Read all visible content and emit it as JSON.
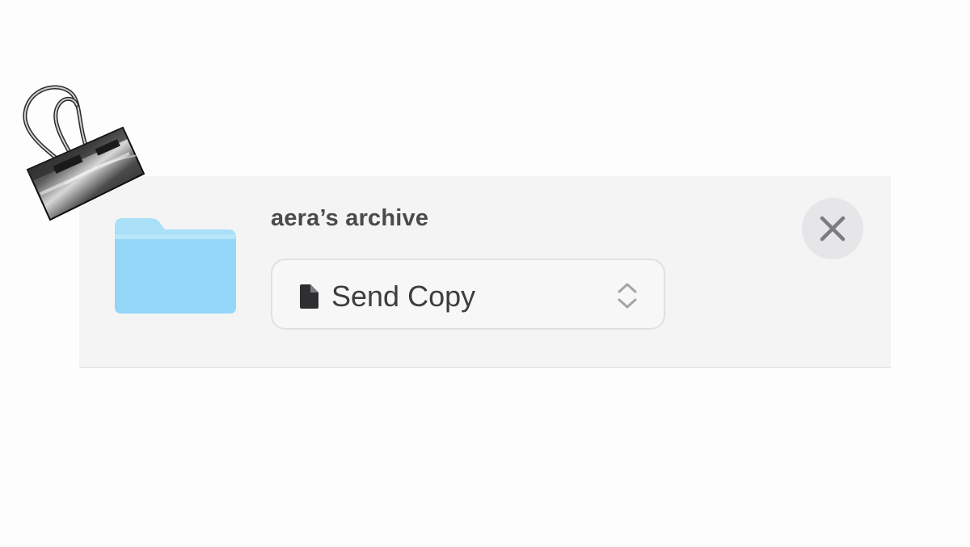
{
  "header": {
    "title": "aera’s archive"
  },
  "action_picker": {
    "selected_label": "Send Copy",
    "icon": "doc-icon",
    "indicator": "chevron-up-down-icon"
  },
  "close_button": {
    "icon": "close-icon"
  },
  "folder": {
    "icon": "folder-icon",
    "color": "#8fd5f6"
  },
  "decoration": {
    "icon": "binder-clip-icon"
  }
}
